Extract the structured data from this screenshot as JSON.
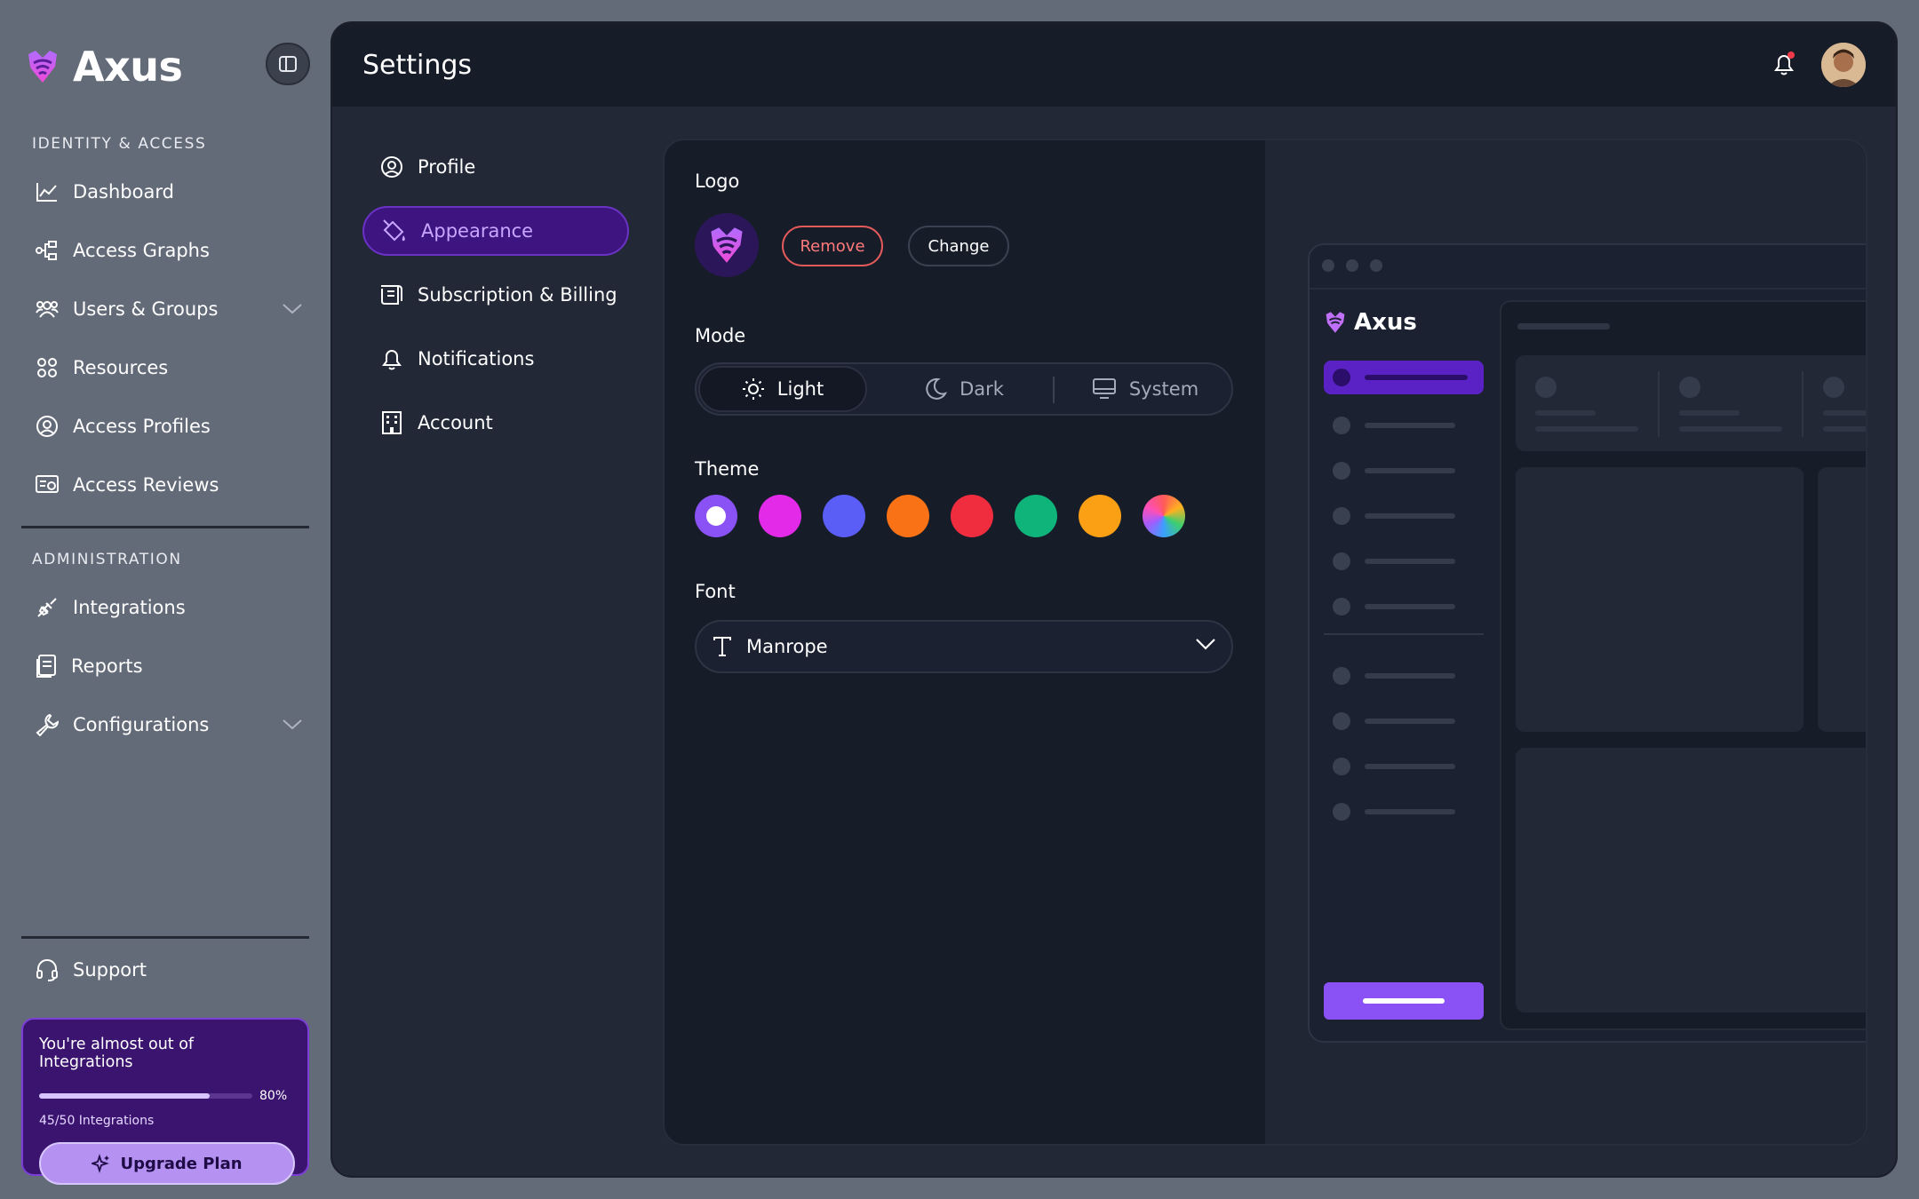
{
  "brand": {
    "name": "Axus",
    "accent": "#8a52f5"
  },
  "sidebar": {
    "sections": [
      {
        "label": "IDENTITY & ACCESS",
        "items": [
          {
            "label": "Dashboard",
            "icon": "chart-line-icon"
          },
          {
            "label": "Access Graphs",
            "icon": "graph-nodes-icon"
          },
          {
            "label": "Users & Groups",
            "icon": "users-icon",
            "expandable": true
          },
          {
            "label": "Resources",
            "icon": "grid-dots-icon"
          },
          {
            "label": "Access Profiles",
            "icon": "profile-gear-icon"
          },
          {
            "label": "Access Reviews",
            "icon": "review-list-icon"
          }
        ]
      },
      {
        "label": "ADMINISTRATION",
        "items": [
          {
            "label": "Integrations",
            "icon": "plug-icon"
          },
          {
            "label": "Reports",
            "icon": "report-icon"
          },
          {
            "label": "Configurations",
            "icon": "wrench-icon",
            "expandable": true
          }
        ]
      }
    ],
    "support": {
      "label": "Support",
      "icon": "headset-icon"
    },
    "upsell": {
      "title": "You're almost out of Integrations",
      "progress_pct": "80%",
      "progress_value": 0.8,
      "count": "45/50 Integrations",
      "button": "Upgrade Plan"
    }
  },
  "header": {
    "title": "Settings",
    "notification_unread": true
  },
  "settings_nav": [
    {
      "label": "Profile",
      "icon": "user-circle-icon",
      "active": false
    },
    {
      "label": "Appearance",
      "icon": "paint-bucket-icon",
      "active": true
    },
    {
      "label": "Subscription & Billing",
      "icon": "receipt-icon",
      "active": false
    },
    {
      "label": "Notifications",
      "icon": "bell-icon",
      "active": false
    },
    {
      "label": "Account",
      "icon": "building-icon",
      "active": false
    }
  ],
  "appearance": {
    "logo": {
      "label": "Logo",
      "remove": "Remove",
      "change": "Change"
    },
    "mode": {
      "label": "Mode",
      "options": [
        "Light",
        "Dark",
        "System"
      ],
      "selected": "Light"
    },
    "theme": {
      "label": "Theme",
      "colors": [
        "#8a52f5",
        "#e22ae8",
        "#5b5ef6",
        "#f97316",
        "#ef2d3f",
        "#0fb47a",
        "#fba014",
        "multicolor"
      ],
      "selected_index": 0
    },
    "font": {
      "label": "Font",
      "value": "Manrope"
    }
  },
  "preview": {
    "brand": "Axus"
  }
}
